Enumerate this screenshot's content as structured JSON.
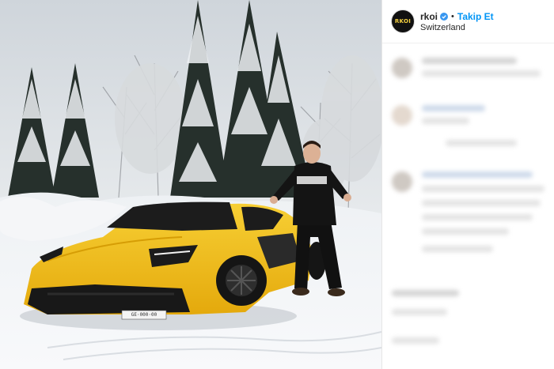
{
  "post": {
    "username": "rkoi",
    "avatar_text": "RKOI",
    "separator": "•",
    "follow_label": "Takip Et",
    "location": "Switzerland",
    "verified_icon": "verified-badge-icon",
    "license_plate": "GE·000·00"
  },
  "colors": {
    "follow_blue": "#0095f6",
    "car_yellow": "#f2bf1a",
    "verified_blue": "#3897f0"
  }
}
